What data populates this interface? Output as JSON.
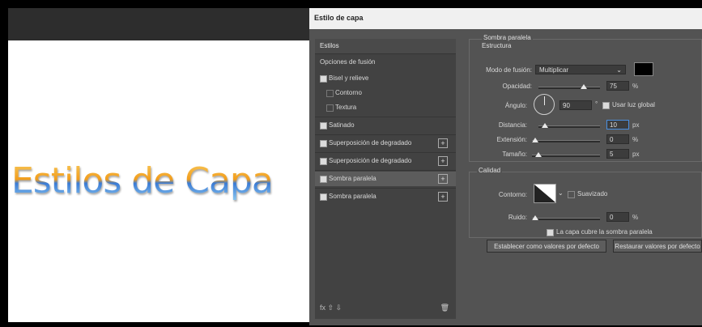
{
  "canvas": {
    "text": "Estilos de Capa"
  },
  "dialog": {
    "title": "Estilo de capa",
    "left_items": [
      {
        "label": "Estilos",
        "type": "header"
      },
      {
        "label": "Opciones de fusión",
        "type": "plain"
      },
      {
        "label": "Bisel y relieve",
        "type": "check"
      },
      {
        "label": "Contorno",
        "type": "subcheck"
      },
      {
        "label": "Textura",
        "type": "subcheck"
      },
      {
        "label": "Satinado",
        "type": "check"
      },
      {
        "label": "Superposición de degradado",
        "type": "check-plus"
      },
      {
        "label": "Superposición de degradado",
        "type": "check-plus"
      },
      {
        "label": "Sombra paralela",
        "type": "check-plus-selected"
      },
      {
        "label": "Sombra paralela",
        "type": "check-plus"
      }
    ],
    "bottom_icons": "fx  ⇧  ⇩",
    "trash_icon": "trash-icon",
    "right": {
      "group_title": "Sombra paralela",
      "structure_title": "Estructura",
      "blend_label": "Modo de fusión:",
      "blend_value": "Multiplicar",
      "opacity_label": "Opacidad:",
      "opacity_value": "75",
      "angle_label": "Ángulo:",
      "angle_value": "90",
      "global_light_label": "Usar luz global",
      "distance_label": "Distancia:",
      "distance_value": "10",
      "spread_label": "Extensión:",
      "spread_value": "0",
      "size_label": "Tamaño:",
      "size_value": "5",
      "quality_title": "Calidad",
      "contour_label": "Contorno:",
      "antialias_label": "Suavizado",
      "noise_label": "Ruido:",
      "noise_value": "0",
      "knockout_label": "La capa cubre la sombra paralela",
      "default_btn": "Establecer como valores por defecto",
      "reset_btn": "Restaurar valores por defecto",
      "unit_percent": "%",
      "unit_px": "px",
      "unit_degree": "°"
    }
  },
  "colors": {
    "accent": "#4a8fe0",
    "panel": "#535353",
    "shadow_color": "#000000"
  }
}
